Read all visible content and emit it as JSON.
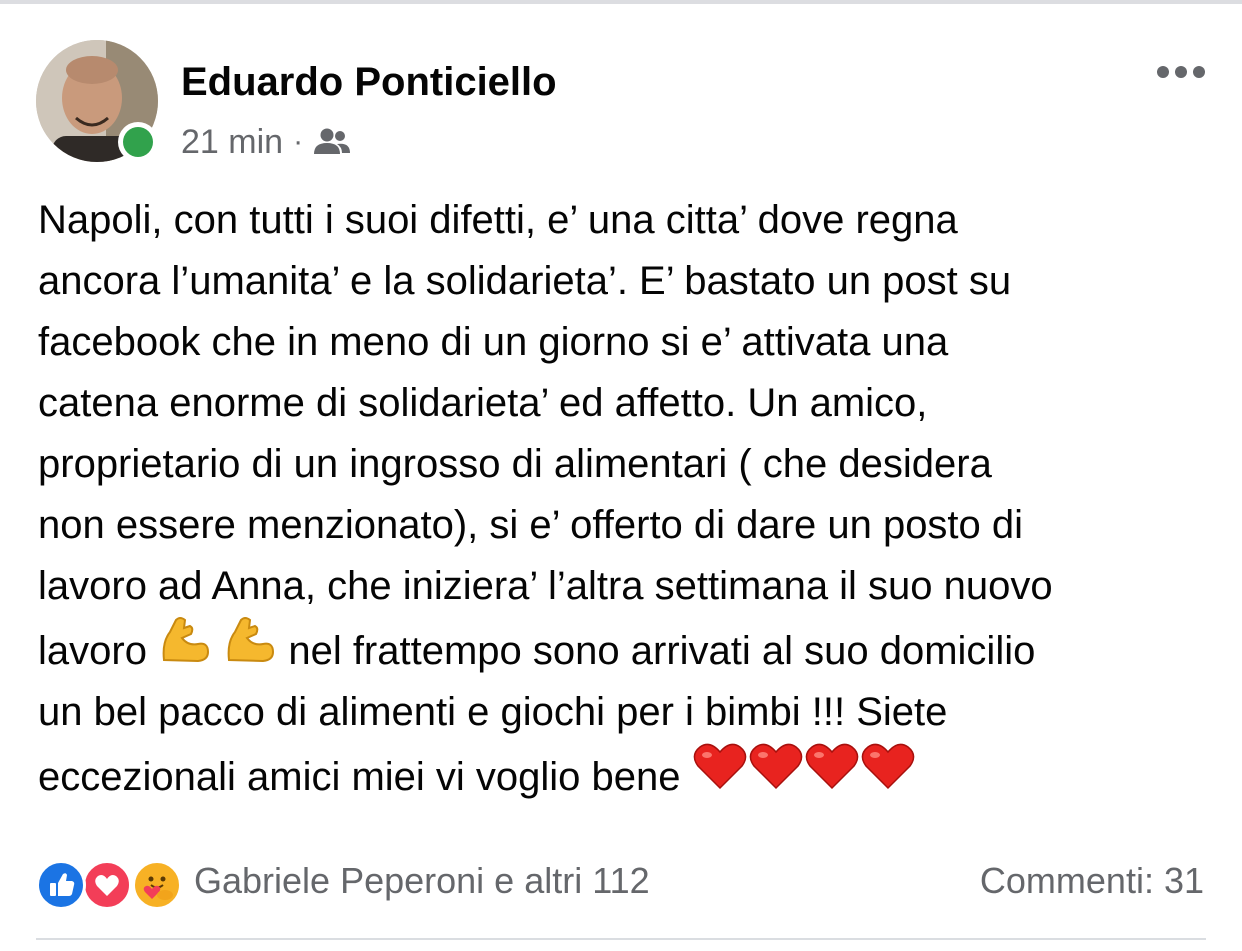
{
  "post": {
    "author": "Eduardo Ponticiello",
    "timestamp": "21 min",
    "separator": "·",
    "audience_icon": "friends-icon",
    "online": true,
    "body_lines": [
      "Napoli, con tutti i suoi difetti, e’ una citta’ dove regna",
      "ancora l’umanita’ e la solidarieta’. E’ bastato un post su",
      "facebook che in meno di un giorno si e’ attivata una",
      "catena enorme di solidarieta’ ed affetto. Un amico,",
      "proprietario di un ingrosso di alimentari ( che desidera",
      "non essere menzionato), si e’ offerto di dare un posto di",
      "lavoro ad Anna, che iniziera’ l’altra settimana il suo nuovo"
    ],
    "line8_before": "lavoro",
    "line8_after": "nel frattempo sono arrivati al suo domicilio",
    "line9": "un bel pacco di alimenti e giochi per i bimbi !!! Siete",
    "line10": "eccezionali amici miei vi voglio bene",
    "emojis": {
      "line8": [
        "flexed-biceps",
        "flexed-biceps"
      ],
      "line10": [
        "red-heart",
        "red-heart",
        "red-heart",
        "red-heart"
      ]
    }
  },
  "reactions": {
    "icons": [
      "like-icon",
      "love-icon",
      "care-icon"
    ],
    "summary": "Gabriele Peperoni e altri 112"
  },
  "comments": {
    "label": "Commenti: 31"
  },
  "colors": {
    "text_primary": "#050505",
    "text_secondary": "#65676b",
    "online_green": "#31a24c",
    "like_blue": "#1b74e4",
    "love_red": "#f33e58",
    "care_yellow": "#f7b125"
  }
}
